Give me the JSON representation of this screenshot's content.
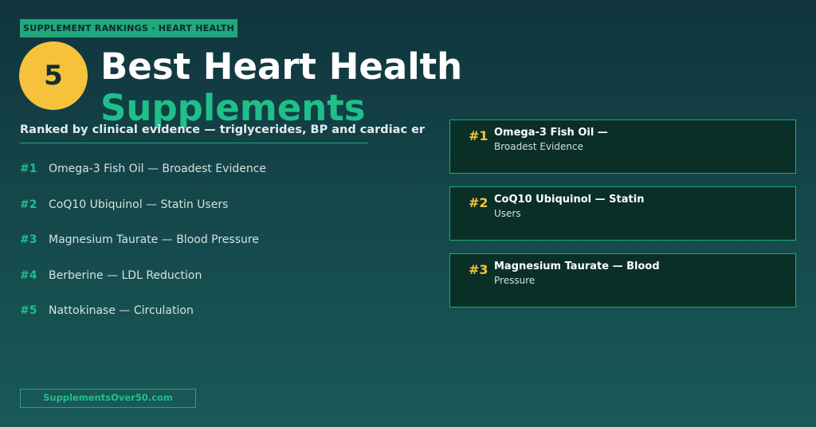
{
  "header": {
    "tag": "SUPPLEMENT RANKINGS · HEART HEALTH",
    "badge_number": "5",
    "title_line1": "Best Heart Health",
    "title_line2": "Supplements",
    "subtitle": "Ranked by clinical evidence — triglycerides, BP and cardiac er"
  },
  "rankings": [
    {
      "rank": "#1",
      "text": "Omega-3 Fish Oil — Broadest Evidence"
    },
    {
      "rank": "#2",
      "text": "CoQ10 Ubiquinol — Statin Users"
    },
    {
      "rank": "#3",
      "text": "Magnesium Taurate — Blood Pressure"
    },
    {
      "rank": "#4",
      "text": "Berberine — LDL Reduction"
    },
    {
      "rank": "#5",
      "text": "Nattokinase — Circulation"
    }
  ],
  "cards": [
    {
      "rank": "#1",
      "title": "Omega-3 Fish Oil —",
      "subtitle": "Broadest Evidence"
    },
    {
      "rank": "#2",
      "title": "CoQ10 Ubiquinol — Statin",
      "subtitle": "Users"
    },
    {
      "rank": "#3",
      "title": "Magnesium Taurate — Blood",
      "subtitle": "Pressure"
    }
  ],
  "footer": {
    "site": "SupplementsOver50.com"
  },
  "colors": {
    "accent_green": "#1fbf8a",
    "badge_yellow": "#f6c23c",
    "background": "#14464a"
  }
}
